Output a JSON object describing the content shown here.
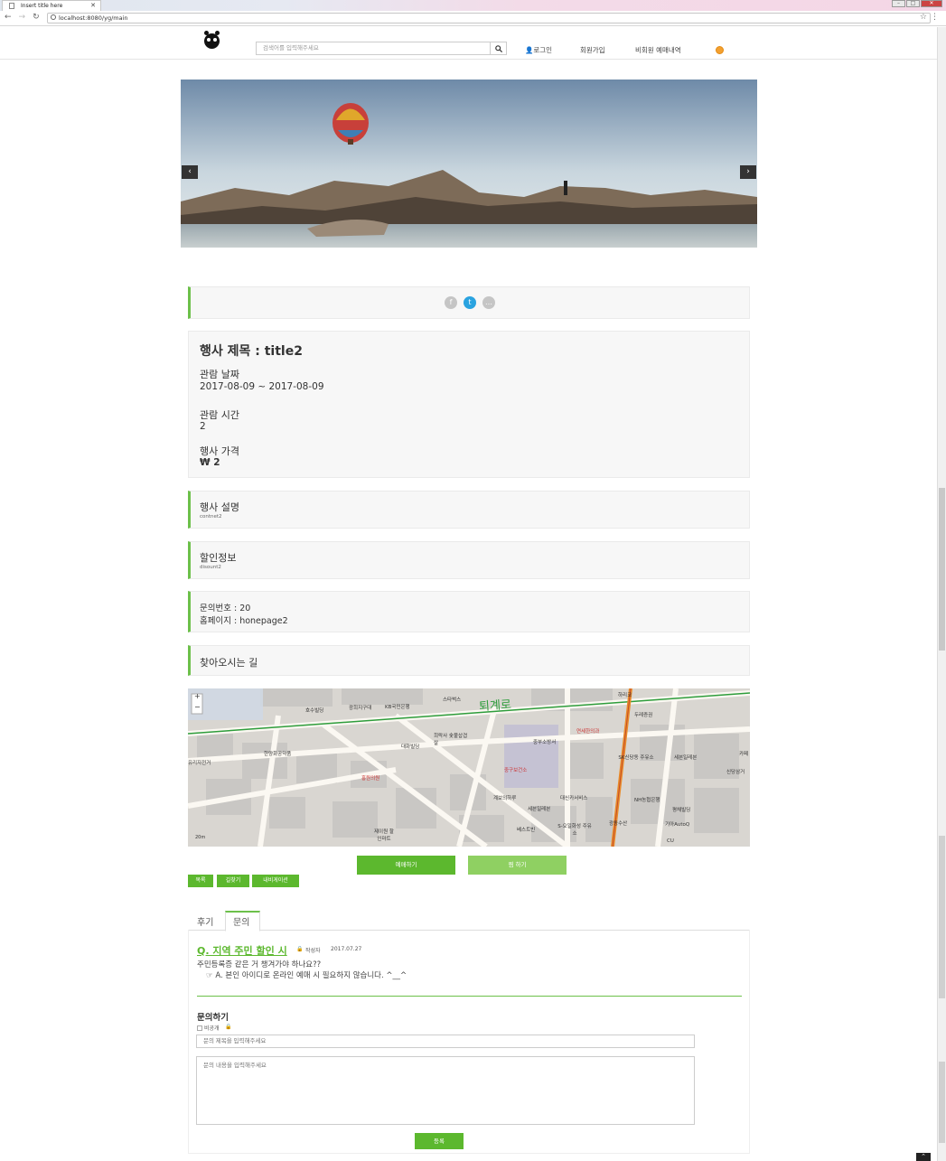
{
  "browser": {
    "tab_title": "Insert title here",
    "url": "localhost:8080/yg/main"
  },
  "header": {
    "search_placeholder": "검색어를 입력해주세요",
    "nav": [
      "로그인",
      "회원가입",
      "비회원 예매내역"
    ]
  },
  "event": {
    "title": "행사 제목 : title2",
    "date_label": "관람 날짜",
    "date_value": "2017-08-09 ~ 2017-08-09",
    "time_label": "관람 시간",
    "time_value": "2",
    "price_label": "행사 가격",
    "price_value": "₩ 2"
  },
  "description": {
    "label": "행사 설명",
    "value": "contnet2"
  },
  "discount": {
    "label": "할인정보",
    "value": "disount2"
  },
  "contact": {
    "number": "문의번호 : 20",
    "homepage": "홈페이지 : honepage2"
  },
  "directions": {
    "label": "찾아오시는 길"
  },
  "map": {
    "zoom_in": "+",
    "zoom_out": "−",
    "road_label": "퇴계로",
    "places": [
      "스타벅스",
      "호수빌딩",
      "광희지구대",
      "KB국민은행",
      "하리코",
      "두레증권",
      "대화빌딩",
      "희락사 숯불삽겹살",
      "중부소방서",
      "연세한의과",
      "한양화공약품",
      "중구보건소",
      "SK신당동 주유소",
      "세븐일레븐",
      "카페",
      "신당삼거",
      "계보의하루",
      "대신카서비스",
      "NH농협은행",
      "세븐일레븐",
      "CU",
      "S-오일화성 주유소",
      "광동수산",
      "평채빌딩",
      "기아AutoQ",
      "베스트빈",
      "제이원 할인마트",
      "홍원의원",
      "유리자전거"
    ],
    "scale": "20m"
  },
  "actions": {
    "reserve": "예매하기",
    "like": "찜 하기"
  },
  "map_buttons": [
    "목록",
    "길찾기",
    "내비게이션"
  ],
  "tabs": [
    "후기",
    "문의"
  ],
  "qna": {
    "title": "Q. 지역 주민 할인 시",
    "author_label": "작성자",
    "date": "2017.07.27",
    "question": "주민등록증 같은 거 챙겨가야 하나요??",
    "answer": "☞ A. 본인 아이디로 온라인 예매 시 필요하지 않습니다. ^__^"
  },
  "inquiry": {
    "heading": "문의하기",
    "private_label": "비공개",
    "title_placeholder": "문의 제목을 입력해주세요",
    "content_placeholder": "문의 내용을 입력해주세요",
    "submit": "등록"
  },
  "colors": {
    "accent": "#5cb82e",
    "accent_light": "#8fd062",
    "panel_border": "#6cc04a"
  }
}
